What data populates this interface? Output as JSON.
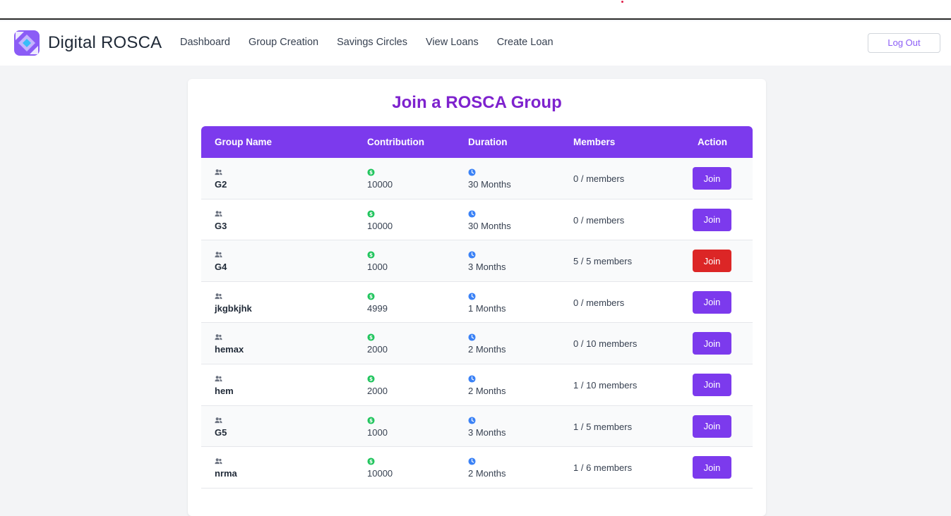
{
  "brand": {
    "title": "Digital ROSCA"
  },
  "nav": {
    "links": [
      "Dashboard",
      "Group Creation",
      "Savings Circles",
      "View Loans",
      "Create Loan"
    ],
    "logout_label": "Log Out"
  },
  "page": {
    "title": "Join a ROSCA Group"
  },
  "table": {
    "headers": [
      "Group Name",
      "Contribution",
      "Duration",
      "Members",
      "Action"
    ],
    "rows": [
      {
        "name": "G2",
        "contribution": "10000",
        "duration": "30 Months",
        "members": "0 / members",
        "action": "Join",
        "status": "open"
      },
      {
        "name": "G3",
        "contribution": "10000",
        "duration": "30 Months",
        "members": "0 / members",
        "action": "Join",
        "status": "open"
      },
      {
        "name": "G4",
        "contribution": "1000",
        "duration": "3 Months",
        "members": "5 / 5 members",
        "action": "Join",
        "status": "full"
      },
      {
        "name": "jkgbkjhk",
        "contribution": "4999",
        "duration": "1 Months",
        "members": "0 / members",
        "action": "Join",
        "status": "open"
      },
      {
        "name": "hemax",
        "contribution": "2000",
        "duration": "2 Months",
        "members": "0 / 10 members",
        "action": "Join",
        "status": "open"
      },
      {
        "name": "hem",
        "contribution": "2000",
        "duration": "2 Months",
        "members": "1 / 10 members",
        "action": "Join",
        "status": "open"
      },
      {
        "name": "G5",
        "contribution": "1000",
        "duration": "3 Months",
        "members": "1 / 5 members",
        "action": "Join",
        "status": "open"
      },
      {
        "name": "nrma",
        "contribution": "10000",
        "duration": "2 Months",
        "members": "1 / 6 members",
        "action": "Join",
        "status": "open"
      }
    ]
  },
  "icons": {
    "group": "users-icon",
    "contribution": "dollar-circle-icon",
    "duration": "clock-icon"
  },
  "colors": {
    "accent": "#7c3aed",
    "title": "#7e22ce",
    "danger": "#dc2626",
    "money": "#22c55e",
    "clock": "#3b82f6"
  }
}
